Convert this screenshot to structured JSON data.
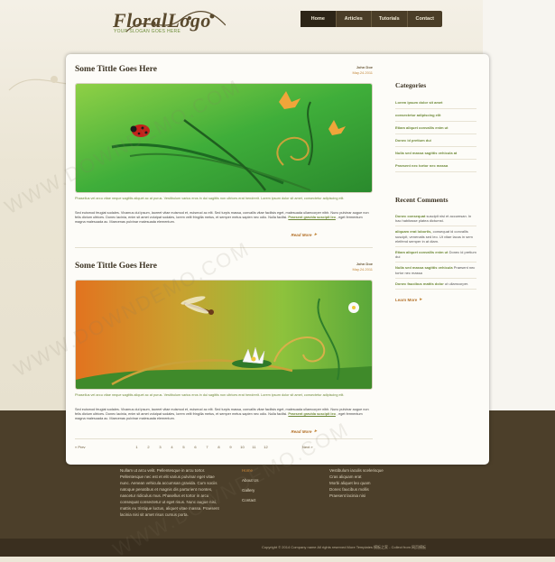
{
  "header": {
    "logo_text": "FloralLogo",
    "slogan": "YOUR SLOGAN GOES HERE",
    "nav": [
      {
        "label": "Home",
        "active": true
      },
      {
        "label": "Articles",
        "active": false
      },
      {
        "label": "Tutorials",
        "active": false
      },
      {
        "label": "Contact",
        "active": false
      }
    ]
  },
  "posts": [
    {
      "title": "Some Tittle Goes Here",
      "author": "John Doe",
      "date": "May.24.2011",
      "lede": "Phasellus vel arcu vitae neque sagittis aliquet ac at purus. Vestibulum varius eros in dui sagittis non ultrices erat hendrerit. Lorem ipsum dolor sit amet, consectetur adipiscing elit.",
      "body_start": "Sed euismod feugiat sodales. Vivamus dui ipsum, laoreet vitae euismod et, euismod ac elit. Sed turpis massa, convallis vitae facilisis eget, malesuada ullamcorper nibh. Nunc pulvinar augue non felis dictum ultrices. Donec lacinia, enim sit amet volutpat sodales, lorem velit fringilla metus, et semper metus sapien nec odio. Nulla facilisi.",
      "body_link": "Praesent gravida suscipit leo",
      "body_end": ", eget fermentum magna malesuada ac. Maecenas pulvinar malesuada elementum.",
      "read_more": "Read More"
    },
    {
      "title": "Some Tittle Goes Here",
      "author": "John Doe",
      "date": "May.24.2011",
      "lede": "Phasellus vel arcu vitae neque sagittis aliquet ac at purus. Vestibulum varius eros in dui sagittis non ultrices erat hendrerit. Lorem ipsum dolor sit amet, consectetur adipiscing elit.",
      "body_start": "Sed euismod feugiat sodales. Vivamus dui ipsum, laoreet vitae euismod et, euismod ac elit. Sed turpis massa, convallis vitae facilisis eget, malesuada ullamcorper nibh. Nunc pulvinar augue non felis dictum ultrices. Donec lacinia, enim sit amet volutpat sodales, lorem velit fringilla metus, et semper metus sapien nec odio. Nulla facilisi.",
      "body_link": "Praesent gravida suscipit leo",
      "body_end": ", eget fermentum magna malesuada ac. Maecenas pulvinar malesuada elementum.",
      "read_more": "Read More"
    }
  ],
  "sidebar": {
    "categories_title": "Categories",
    "categories": [
      "Lorem ipsum dolor sit amet",
      "consectetur adipiscing elit",
      "Etiam aliquet convallis enim ut",
      "Donec id pretium dui",
      "Nulla sed massa sagittis vehicula at",
      "Praesent nec tortor nec massa"
    ],
    "recent_title": "Recent Comments",
    "recent": [
      {
        "author": "Donec consequat",
        "text": "suscipit nisi et accumsan. In hac habitasse platea dictumst."
      },
      {
        "author": "aliquam erat lobortis,",
        "text": "consequat id convallis suscipit, venenatis sed leo. Ut vitae lacus in sem eleifend semper in at diam."
      },
      {
        "author": "Etiam aliquet convallis enim ut",
        "text": "Donec id pretium dui"
      },
      {
        "author": "Nulla sed massa sagittis vehicula",
        "text": "Praesent nec tortor nec massa"
      },
      {
        "author": "Donec faucibus mattis dolor",
        "text": "ut ullamcorper."
      }
    ],
    "more": "Learn More"
  },
  "pagination": {
    "prev": "« Prev",
    "next": "Next »",
    "pages": [
      "1",
      "2",
      "3",
      "4",
      "5",
      "6",
      "7",
      "8",
      "9",
      "10",
      "11",
      "12"
    ]
  },
  "footer": {
    "about": "Nullam ut arcu velit. Pellentesque in arcu tortor. Pellentesque nec est et elit varius pulvinar eget vitae nunc. Aenean vehicula accumsan gravida. Cum sociis natoque penatibus et magnis dis parturient montes, nascetur ridiculus mus. Phasellus et tortor in arcu consequat consectetur ut eget risus. Nunc augue nisi, mattis eu tristique luctus, aliquet vitae massa. Praesent lacinia nisi sit amet risus cursus porta.",
    "nav": [
      {
        "label": "Home",
        "active": true
      },
      {
        "label": "About Us",
        "active": false
      },
      {
        "label": "Gallery",
        "active": false
      },
      {
        "label": "Contact",
        "active": false
      }
    ],
    "links": [
      "Vestibulum iaculis scelerisque",
      "Cras aliquam erat",
      "Morbi aliquet leo quam",
      "Donec faucibus mollis",
      "Praesent lacinia nisi"
    ],
    "copyright": "Copyright © 2014 Company name All rights reserved More Templates 模板之家 - Collect from 网页模板"
  },
  "watermark": "WWW.DOWNDEMO.COM",
  "colors": {
    "accent_green": "#6f8a3a",
    "accent_orange": "#b4722b",
    "band_brown": "#4c3f2a"
  }
}
